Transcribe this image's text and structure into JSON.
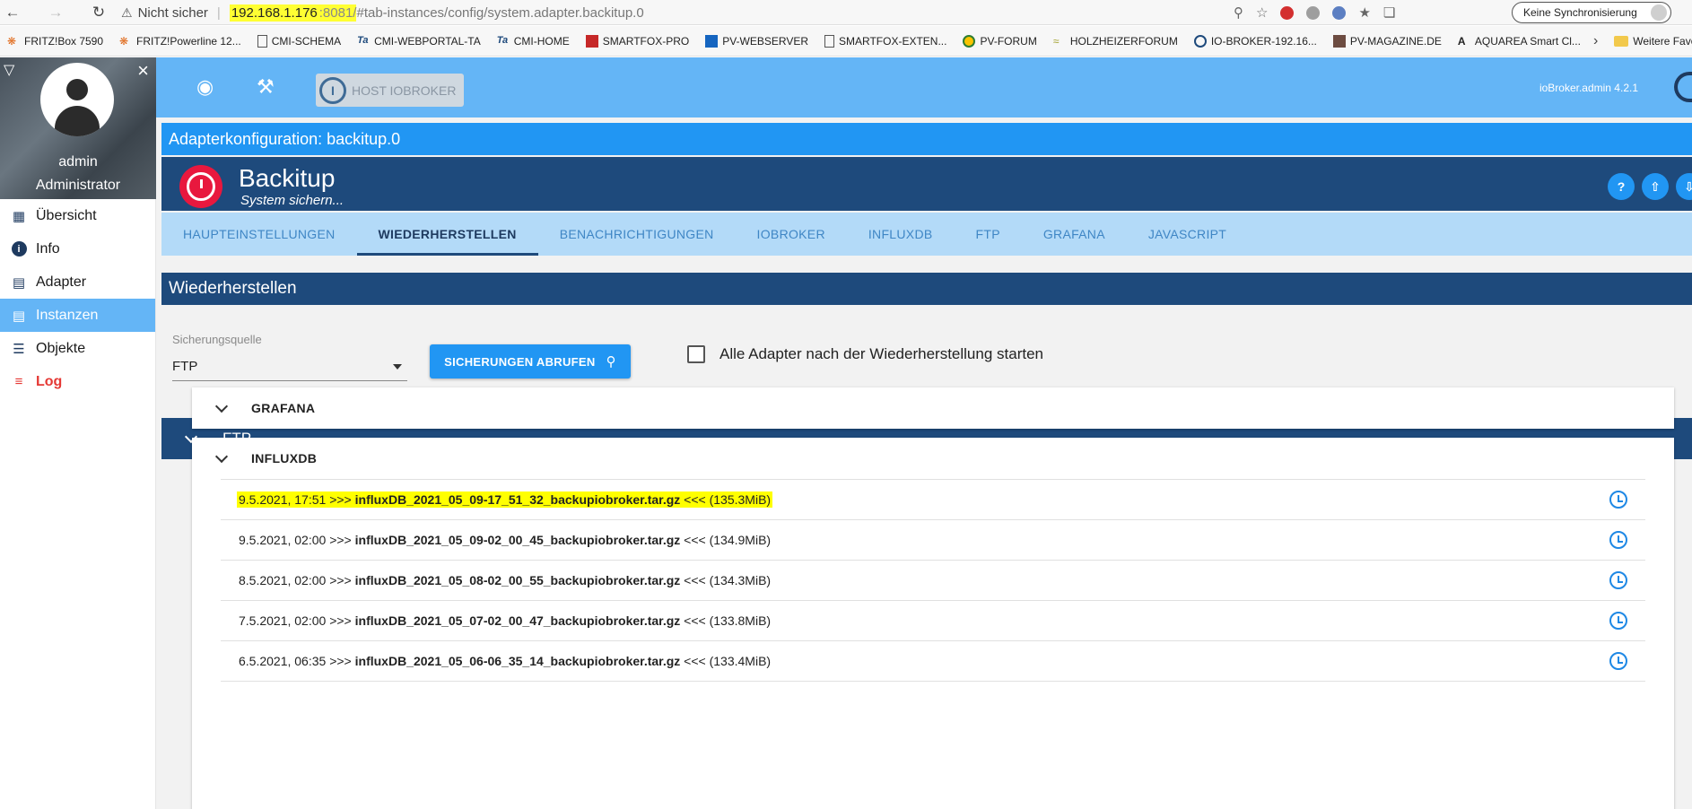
{
  "browser": {
    "security_text": "Nicht sicher",
    "separator": "|",
    "url_host": "192.168.1.176",
    "url_port": ":8081/",
    "url_path": "#tab-instances/config/system.adapter.backitup.0",
    "sync_label": "Keine Synchronisierung",
    "bookmarks": [
      {
        "label": "FRITZ!Box 7590"
      },
      {
        "label": "FRITZ!Powerline 12..."
      },
      {
        "label": "CMI-SCHEMA"
      },
      {
        "label": "CMI-WEBPORTAL-TA"
      },
      {
        "label": "CMI-HOME"
      },
      {
        "label": "SMARTFOX-PRO"
      },
      {
        "label": "PV-WEBSERVER"
      },
      {
        "label": "SMARTFOX-EXTEN..."
      },
      {
        "label": "PV-FORUM"
      },
      {
        "label": "HOLZHEIZERFORUM"
      },
      {
        "label": "IO-BROKER-192.16..."
      },
      {
        "label": "PV-MAGAZINE.DE"
      },
      {
        "label": "AQUAREA Smart Cl..."
      }
    ],
    "bookmarks_more": "Weitere Favorit"
  },
  "sidebar": {
    "user_name": "admin",
    "user_role": "Administrator",
    "items": [
      {
        "label": "Übersicht",
        "icon": "grid-icon"
      },
      {
        "label": "Info",
        "icon": "info-icon"
      },
      {
        "label": "Adapter",
        "icon": "store-icon"
      },
      {
        "label": "Instanzen",
        "icon": "instances-icon"
      },
      {
        "label": "Objekte",
        "icon": "list-icon"
      },
      {
        "label": "Log",
        "icon": "log-icon"
      }
    ],
    "active_item": "Instanzen"
  },
  "appbar": {
    "host_label": "HOST IOBROKER",
    "version": "ioBroker.admin 4.2.1"
  },
  "config": {
    "title": "Adapterkonfiguration: backitup.0",
    "adapter_name": "Backitup",
    "adapter_desc": "System sichern...",
    "tabs": [
      {
        "label": "HAUPTEINSTELLUNGEN"
      },
      {
        "label": "WIEDERHERSTELLEN"
      },
      {
        "label": "BENACHRICHTIGUNGEN"
      },
      {
        "label": "IOBROKER"
      },
      {
        "label": "INFLUXDB"
      },
      {
        "label": "FTP"
      },
      {
        "label": "GRAFANA"
      },
      {
        "label": "JAVASCRIPT"
      }
    ],
    "active_tab": "WIEDERHERSTELLEN",
    "section_title": "Wiederherstellen",
    "source_label": "Sicherungsquelle",
    "source_value": "FTP",
    "fetch_button": "SICHERUNGEN ABRUFEN",
    "start_adapters_label": "Alle Adapter nach der Wiederherstellung starten",
    "start_adapters_checked": false
  },
  "backups": {
    "group_title": "FTP",
    "grafana_title": "GRAFANA",
    "influx_title": "INFLUXDB",
    "influx_items": [
      {
        "date": "9.5.2021, 17:51",
        "prefix": ">>>",
        "file": "influxDB_2021_05_09-17_51_32_backupiobroker.tar.gz",
        "suffix": "<<<",
        "size": "(135.3MiB)",
        "highlighted": true
      },
      {
        "date": "9.5.2021, 02:00",
        "prefix": ">>>",
        "file": "influxDB_2021_05_09-02_00_45_backupiobroker.tar.gz",
        "suffix": "<<<",
        "size": "(134.9MiB)",
        "highlighted": false
      },
      {
        "date": "8.5.2021, 02:00",
        "prefix": ">>>",
        "file": "influxDB_2021_05_08-02_00_55_backupiobroker.tar.gz",
        "suffix": "<<<",
        "size": "(134.3MiB)",
        "highlighted": false
      },
      {
        "date": "7.5.2021, 02:00",
        "prefix": ">>>",
        "file": "influxDB_2021_05_07-02_00_47_backupiobroker.tar.gz",
        "suffix": "<<<",
        "size": "(133.8MiB)",
        "highlighted": false
      },
      {
        "date": "6.5.2021, 06:35",
        "prefix": ">>>",
        "file": "influxDB_2021_05_06-06_35_14_backupiobroker.tar.gz",
        "suffix": "<<<",
        "size": "(133.4MiB)",
        "highlighted": false
      }
    ]
  },
  "colors": {
    "accent": "#2196f3",
    "header_dark": "#1e4a7c",
    "appbar": "#64b5f6",
    "log_red": "#e53935",
    "highlight": "#ffff00"
  }
}
